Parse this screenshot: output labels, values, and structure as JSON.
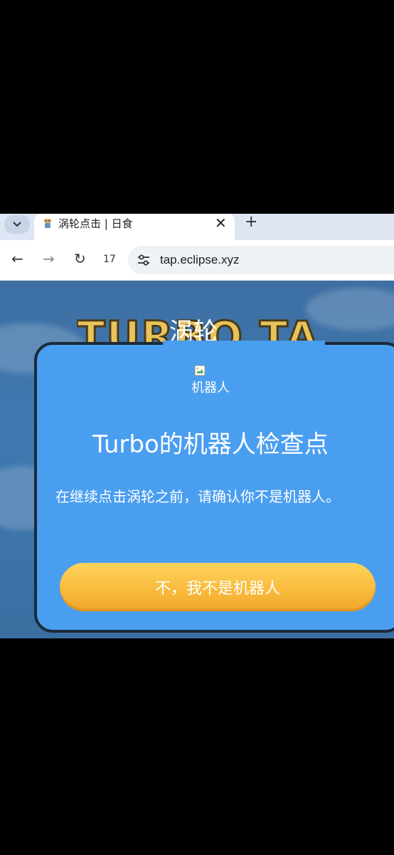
{
  "browser": {
    "tab": {
      "title": "涡轮点击 | 日食",
      "close_glyph": "✕"
    },
    "tab_list_glyph": "⌄",
    "new_tab_glyph": "+",
    "nav": {
      "back_glyph": "←",
      "forward_glyph": "→",
      "reload_glyph": "↻",
      "tab_count": "17"
    },
    "url": "tap.eclipse.xyz"
  },
  "page": {
    "banner_text": "TURBO TAP",
    "header_label": "涡轮",
    "dialog": {
      "image_alt": "机器人",
      "title": "Turbo的机器人检查点",
      "body": "在继续点击涡轮之前，请确认你不是机器人。",
      "confirm_button": "不，我不是机器人"
    }
  },
  "colors": {
    "dialog_bg": "#4a9ef0",
    "button_bg": "#f8b93a",
    "page_bg": "#3f79b0"
  },
  "icons": [
    "chevron-down-icon",
    "favicon-icon",
    "close-icon",
    "plus-icon",
    "back-arrow-icon",
    "forward-arrow-icon",
    "reload-icon",
    "site-info-icon",
    "broken-image-icon"
  ]
}
